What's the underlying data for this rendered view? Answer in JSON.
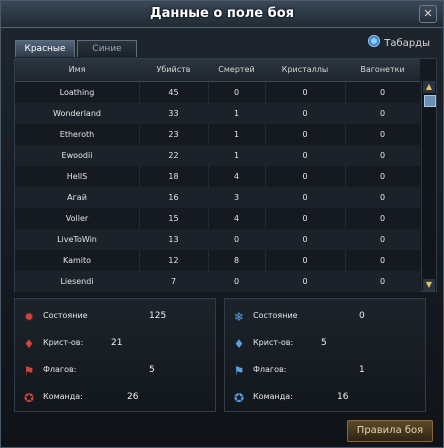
{
  "window": {
    "title": "Данные о поле боя",
    "close_glyph": "✕"
  },
  "tabs": [
    {
      "label": "Красные",
      "active": true
    },
    {
      "label": "Синие",
      "active": false
    }
  ],
  "tabards_label": "Табарды",
  "table": {
    "columns": [
      "Имя",
      "Убийств",
      "Смертей",
      "Кристаллы",
      "Вагонетки"
    ],
    "rows": [
      [
        "Loathing",
        "45",
        "0",
        "0",
        "0"
      ],
      [
        "Wonderland",
        "33",
        "1",
        "0",
        "0"
      ],
      [
        "Etheroth",
        "23",
        "1",
        "0",
        "0"
      ],
      [
        "Ewoodii",
        "22",
        "1",
        "0",
        "0"
      ],
      [
        "HellS",
        "18",
        "4",
        "0",
        "0"
      ],
      [
        "Агай",
        "16",
        "3",
        "0",
        "0"
      ],
      [
        "Voller",
        "15",
        "4",
        "0",
        "0"
      ],
      [
        "LiveToWin",
        "13",
        "0",
        "0",
        "0"
      ],
      [
        "Kamito",
        "12",
        "8",
        "0",
        "0"
      ],
      [
        "Liesendi",
        "7",
        "0",
        "0",
        "0"
      ]
    ]
  },
  "stats_red": [
    {
      "icon": "fire-crystal-icon",
      "label": "Состояние",
      "value": "125"
    },
    {
      "icon": "crystal-cluster-icon",
      "label": "Крист-ов:",
      "value": "21"
    },
    {
      "icon": "flag-icon",
      "label": "Флагов:",
      "value": "5"
    },
    {
      "icon": "team-emblem-icon",
      "label": "Команда:",
      "value": "26"
    }
  ],
  "stats_blue": [
    {
      "icon": "ice-crystal-icon",
      "label": "Состояние",
      "value": "0"
    },
    {
      "icon": "crystal-cluster-icon",
      "label": "Крист-ов:",
      "value": "5"
    },
    {
      "icon": "flag-icon",
      "label": "Флагов:",
      "value": "1"
    },
    {
      "icon": "team-emblem-icon",
      "label": "Команда:",
      "value": "16"
    }
  ],
  "colors": {
    "red_team": "#d0443a",
    "blue_team": "#5a9fe0",
    "accent_gold": "#e6c45a"
  },
  "rules_button": "Правила боя"
}
